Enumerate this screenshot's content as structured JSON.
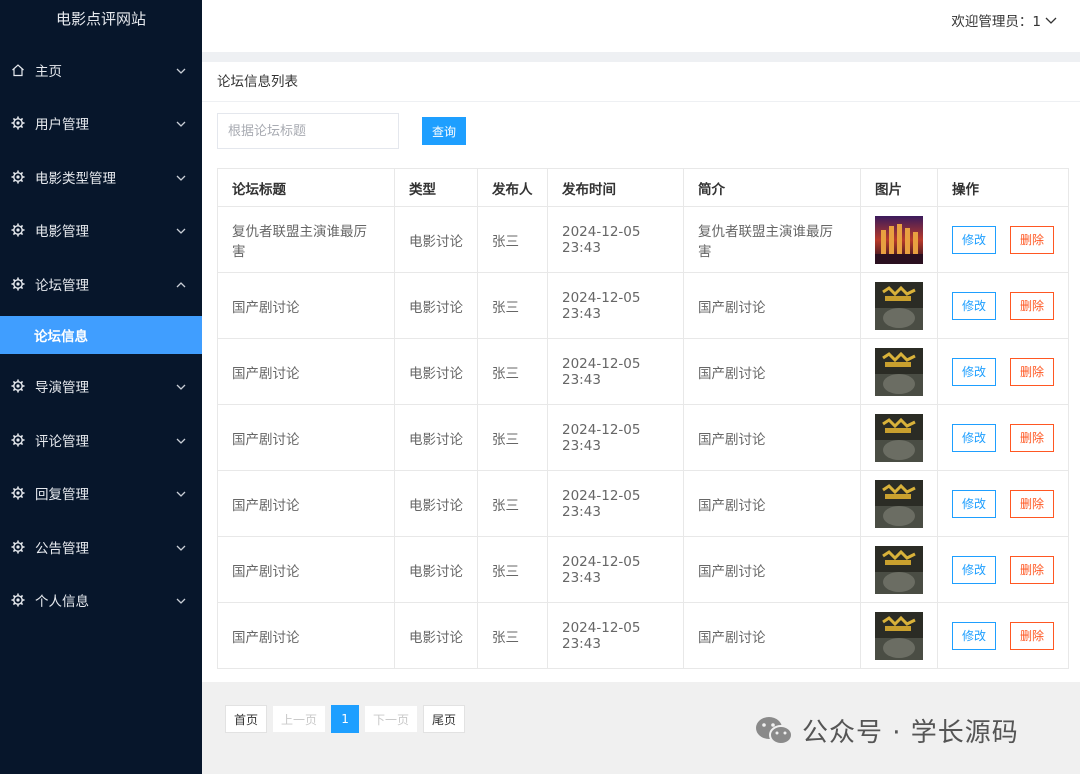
{
  "app": {
    "title": "电影点评网站"
  },
  "header": {
    "welcome": "欢迎管理员：1"
  },
  "sidebar": {
    "items": [
      {
        "label": "主页",
        "icon": "home-icon"
      },
      {
        "label": "用户管理",
        "icon": "gear-icon"
      },
      {
        "label": "电影类型管理",
        "icon": "gear-icon"
      },
      {
        "label": "电影管理",
        "icon": "gear-icon"
      },
      {
        "label": "论坛管理",
        "icon": "gear-icon"
      },
      {
        "label": "论坛信息",
        "icon": ""
      },
      {
        "label": "导演管理",
        "icon": "gear-icon"
      },
      {
        "label": "评论管理",
        "icon": "gear-icon"
      },
      {
        "label": "回复管理",
        "icon": "gear-icon"
      },
      {
        "label": "公告管理",
        "icon": "gear-icon"
      },
      {
        "label": "个人信息",
        "icon": "gear-icon"
      }
    ]
  },
  "main": {
    "title": "论坛信息列表",
    "search": {
      "placeholder": "根据论坛标题",
      "value": "",
      "button": "查询"
    },
    "table": {
      "columns": [
        "论坛标题",
        "类型",
        "发布人",
        "发布时间",
        "简介",
        "图片",
        "操作"
      ],
      "rows": [
        {
          "title": "复仇者联盟主演谁最厉害",
          "type": "电影讨论",
          "author": "张三",
          "time": "2024-12-05 23:43",
          "intro": "复仇者联盟主演谁最厉害",
          "image": "avengers-poster"
        },
        {
          "title": "国产剧讨论",
          "type": "电影讨论",
          "author": "张三",
          "time": "2024-12-05 23:43",
          "intro": "国产剧讨论",
          "image": "drama-poster"
        },
        {
          "title": "国产剧讨论",
          "type": "电影讨论",
          "author": "张三",
          "time": "2024-12-05 23:43",
          "intro": "国产剧讨论",
          "image": "drama-poster"
        },
        {
          "title": "国产剧讨论",
          "type": "电影讨论",
          "author": "张三",
          "time": "2024-12-05 23:43",
          "intro": "国产剧讨论",
          "image": "drama-poster"
        },
        {
          "title": "国产剧讨论",
          "type": "电影讨论",
          "author": "张三",
          "time": "2024-12-05 23:43",
          "intro": "国产剧讨论",
          "image": "drama-poster"
        },
        {
          "title": "国产剧讨论",
          "type": "电影讨论",
          "author": "张三",
          "time": "2024-12-05 23:43",
          "intro": "国产剧讨论",
          "image": "drama-poster"
        },
        {
          "title": "国产剧讨论",
          "type": "电影讨论",
          "author": "张三",
          "time": "2024-12-05 23:43",
          "intro": "国产剧讨论",
          "image": "drama-poster"
        }
      ],
      "edit_label": "修改",
      "delete_label": "删除"
    }
  },
  "pagination": {
    "first": "首页",
    "prev": "上一页",
    "current": "1",
    "next": "下一页",
    "last": "尾页"
  },
  "watermark": {
    "text": "公众号 · 学长源码"
  },
  "colors": {
    "sidebar_bg": "#07162b",
    "accent": "#1e9fff",
    "active_menu": "#409eff",
    "danger": "#ff5722"
  }
}
